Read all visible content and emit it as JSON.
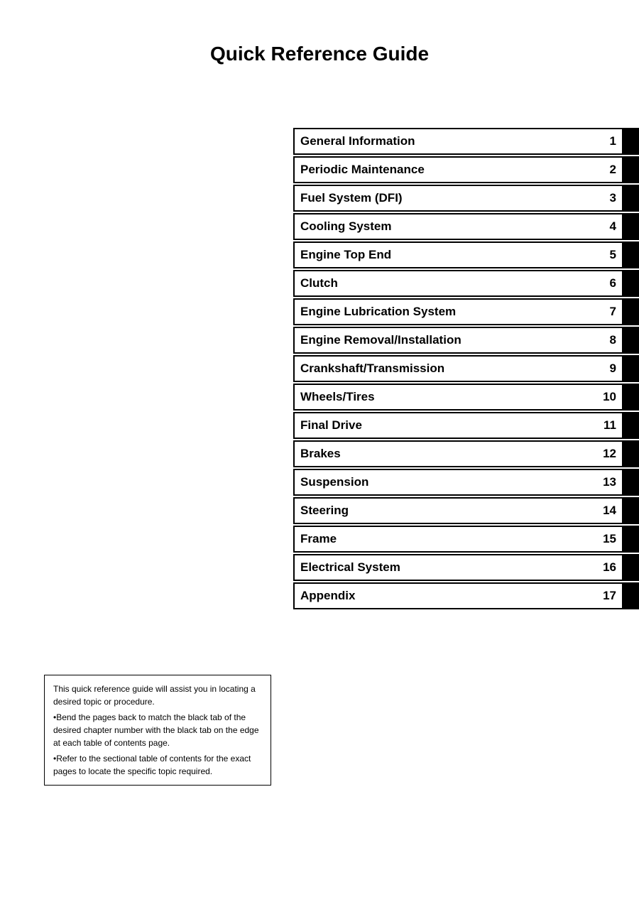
{
  "page": {
    "title": "Quick Reference Guide"
  },
  "toc": {
    "items": [
      {
        "label": "General Information",
        "number": "1"
      },
      {
        "label": "Periodic Maintenance",
        "number": "2"
      },
      {
        "label": "Fuel System (DFI)",
        "number": "3"
      },
      {
        "label": "Cooling System",
        "number": "4"
      },
      {
        "label": "Engine Top End",
        "number": "5"
      },
      {
        "label": "Clutch",
        "number": "6"
      },
      {
        "label": "Engine Lubrication System",
        "number": "7"
      },
      {
        "label": "Engine Removal/Installation",
        "number": "8"
      },
      {
        "label": "Crankshaft/Transmission",
        "number": "9"
      },
      {
        "label": "Wheels/Tires",
        "number": "10"
      },
      {
        "label": "Final Drive",
        "number": "11"
      },
      {
        "label": "Brakes",
        "number": "12"
      },
      {
        "label": "Suspension",
        "number": "13"
      },
      {
        "label": "Steering",
        "number": "14"
      },
      {
        "label": "Frame",
        "number": "15"
      },
      {
        "label": "Electrical System",
        "number": "16"
      },
      {
        "label": "Appendix",
        "number": "17"
      }
    ]
  },
  "info_box": {
    "intro": "This quick reference guide will assist you in locating a desired topic or procedure.",
    "bullet1": "Bend the pages back to match the black tab of the desired chapter number with the black tab on the edge at each table of contents page.",
    "bullet2": "Refer to the sectional table of contents for the exact pages to locate the specific topic required."
  }
}
